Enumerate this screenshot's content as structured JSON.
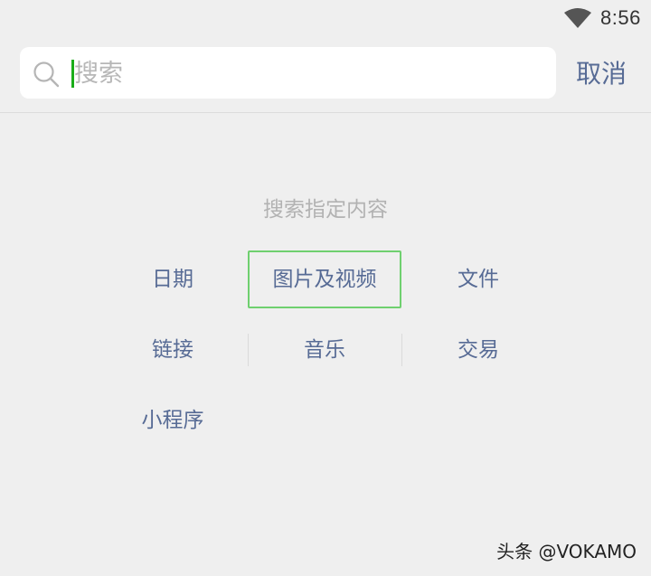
{
  "status_bar": {
    "time": "8:56",
    "wifi_icon": "wifi-icon"
  },
  "search": {
    "placeholder": "搜索",
    "value": "",
    "search_icon": "search-icon",
    "cancel_label": "取消"
  },
  "categories": {
    "title": "搜索指定内容",
    "items": [
      {
        "label": "日期",
        "selected": false
      },
      {
        "label": "图片及视频",
        "selected": true
      },
      {
        "label": "文件",
        "selected": false
      },
      {
        "label": "链接",
        "selected": false
      },
      {
        "label": "音乐",
        "selected": false
      },
      {
        "label": "交易",
        "selected": false
      },
      {
        "label": "小程序",
        "selected": false
      }
    ]
  },
  "watermark": {
    "text": "头条 @VOKAMO"
  },
  "colors": {
    "background": "#efefef",
    "link_blue": "#576b95",
    "caret_green": "#1aad19",
    "selected_border": "#6fd06f",
    "hint_gray": "#b2b2b2"
  }
}
